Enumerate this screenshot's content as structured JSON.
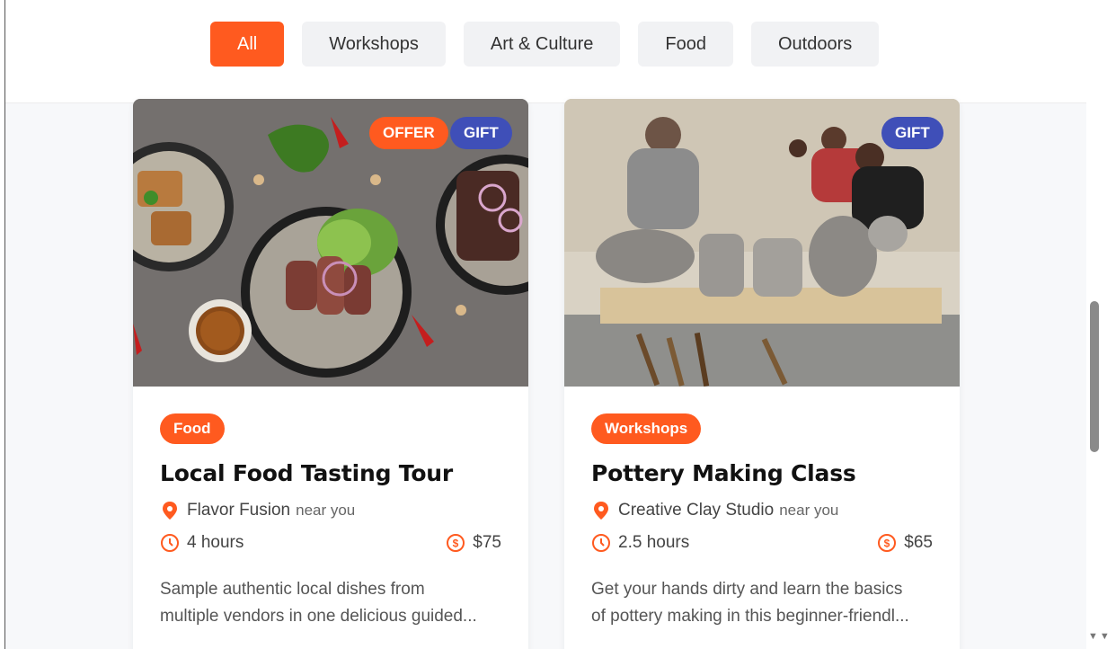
{
  "filters": [
    {
      "label": "All",
      "active": true
    },
    {
      "label": "Workshops",
      "active": false
    },
    {
      "label": "Art & Culture",
      "active": false
    },
    {
      "label": "Food",
      "active": false
    },
    {
      "label": "Outdoors",
      "active": false
    }
  ],
  "cards": [
    {
      "badges": [
        "OFFER",
        "GIFT"
      ],
      "category": "Food",
      "title": "Local Food Tasting Tour",
      "location": "Flavor Fusion",
      "near": "near you",
      "duration": "4 hours",
      "price": "$75",
      "description_lines": [
        "Sample authentic local dishes from",
        "multiple vendors in one delicious guided..."
      ]
    },
    {
      "badges": [
        "GIFT"
      ],
      "category": "Workshops",
      "title": "Pottery Making Class",
      "location": "Creative Clay Studio",
      "near": "near you",
      "duration": "2.5 hours",
      "price": "$65",
      "description_lines": [
        "Get your hands dirty and learn the basics",
        "of pottery making in this beginner-friendl..."
      ]
    }
  ],
  "colors": {
    "accent": "#ff5a1f",
    "gift": "#3f4fb8"
  },
  "icons": {
    "location": "map-pin-icon",
    "duration": "clock-icon",
    "price": "dollar-circle-icon"
  }
}
